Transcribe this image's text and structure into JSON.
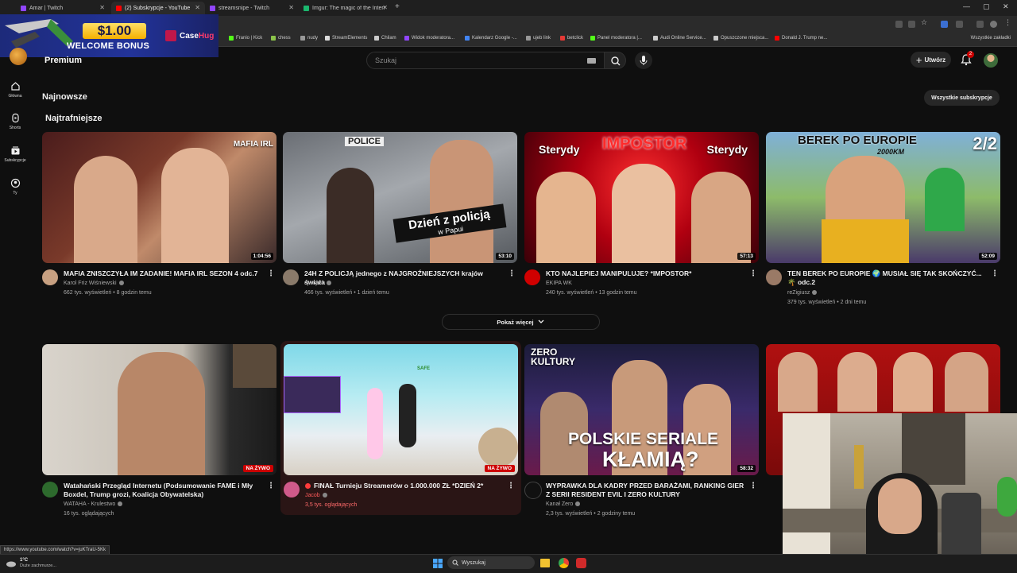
{
  "browser": {
    "tabs": [
      {
        "label": "Amar | Twitch",
        "active": false,
        "icon_color": "#9146ff"
      },
      {
        "label": "(2) Subskrypcje - YouTube",
        "active": true,
        "icon_color": "#ff0000"
      },
      {
        "label": "streamsnipe - Twitch",
        "active": false,
        "icon_color": "#9146ff"
      },
      {
        "label": "Imgur: The magic of the Intern",
        "active": false,
        "icon_color": "#1bb76e"
      }
    ],
    "new_tab": "+",
    "bookmarks": [
      {
        "label": "Franio | Kick",
        "color": "#53fc18"
      },
      {
        "label": "chess",
        "color": "#8bc34a"
      },
      {
        "label": "nudy",
        "color": "#999999"
      },
      {
        "label": "StreamElements",
        "color": "#dddddd"
      },
      {
        "label": "Chilam",
        "color": "#cccccc"
      },
      {
        "label": "Widok moderatora...",
        "color": "#9146ff"
      },
      {
        "label": "Kalendarz Google -...",
        "color": "#4285f4"
      },
      {
        "label": "ujeb link",
        "color": "#999999"
      },
      {
        "label": "betclick",
        "color": "#e53935"
      },
      {
        "label": "Panel moderatora |...",
        "color": "#53fc18"
      },
      {
        "label": "Audi Online Service...",
        "color": "#cccccc"
      },
      {
        "label": "Opuszczone miejsca...",
        "color": "#cccccc"
      },
      {
        "label": "Donald J. Trump ne...",
        "color": "#ff0000"
      }
    ],
    "all_bookmarks": "Wszystkie zakładki",
    "status_url": "https://www.youtube.com/watch?v=juKTraU-5Kk"
  },
  "ad": {
    "amount": "$1.00",
    "subtitle": "WELCOME BONUS",
    "brand_a": "Case",
    "brand_b": "Hug"
  },
  "header": {
    "premium_label": "Premium",
    "search_placeholder": "Szukaj",
    "create_label": "Utwórz",
    "notification_count": "2"
  },
  "nav": [
    {
      "label": "Główna",
      "icon": "home-icon"
    },
    {
      "label": "Shorts",
      "icon": "shorts-icon"
    },
    {
      "label": "Subskrypcje",
      "icon": "subscriptions-icon"
    },
    {
      "label": "Ty",
      "icon": "you-icon"
    }
  ],
  "sections": {
    "newest": "Najnowsze",
    "all_subscriptions": "Wszystkie subskrypcje",
    "most_relevant": "Najtrafniejsze",
    "show_more": "Pokaż więcej"
  },
  "videos_row1": [
    {
      "title": "MAFIA ZNISZCZYŁA IM ZADANIE! MAFIA IRL SEZON 4 odc.7",
      "channel": "Karol Friz Wiśniewski",
      "meta": "662 tys. wyświetleń • 8 godzin temu",
      "duration": "1:04:56",
      "thumb_text": "MAFIA IRL"
    },
    {
      "title": "24H Z POLICJĄ jednego z NAJGROŹNIEJSZYCH krajów świata",
      "channel": "ojwojtek",
      "meta": "466 tys. wyświetleń • 1 dzień temu",
      "duration": "53:10",
      "thumb_text": "Dzień z policją",
      "thumb_text2": "w Papui",
      "thumb_text3": "POLICE"
    },
    {
      "title": "KTO NAJLEPIEJ MANIPULUJE? *IMPOSTOR*",
      "channel": "EKIPA WK",
      "meta": "240 tys. wyświetleń • 13 godzin temu",
      "duration": "57:13",
      "thumb_text": "IMPOSTOR",
      "thumb_left": "Sterydy",
      "thumb_right": "Sterydy"
    },
    {
      "title": "TEN BEREK PO EUROPIE 🌍 MUSIAŁ SIĘ TAK SKOŃCZYĆ... 🌴 odc.2",
      "channel": "reZigiusz",
      "meta": "379 tys. wyświetleń • 2 dni temu",
      "duration": "52:09",
      "thumb_text": "BEREK PO EUROPIE",
      "thumb_text2": "2/2",
      "thumb_text3": "2000KM"
    }
  ],
  "videos_row2": [
    {
      "title": "Watahański Przegląd Internetu (Podsumowanie FAME i Mły Boxdel, Trump grozi, Koalicja Obywatelska)",
      "channel": "WATAHA - Krulestwo",
      "meta": "16 tys. oglądających",
      "badge": "NA ŻYWO"
    },
    {
      "title": "FINAŁ Turnieju Streamerów o 1.000.000 ZŁ *DZIEŃ 2*",
      "channel": "Jacob",
      "meta": "3,5 tys. oglądających",
      "badge": "NA ŻYWO",
      "thumb_text": "SAFE"
    },
    {
      "title": "WYPRAWKA DLA KADRY PRZED BARAŻAMI, RANKING GIER Z SERII RESIDENT EVIL I ZERO KULTURY",
      "channel": "Kanał Zero",
      "meta": "2,3 tys. wyświetleń • 2 godziny temu",
      "duration": "58:32",
      "thumb_text": "POLSKIE SERIALE",
      "thumb_text2": "KŁAMIĄ?",
      "thumb_text3": "ZERO KULTURY"
    },
    {
      "title": "",
      "channel": "",
      "meta": ""
    }
  ],
  "taskbar": {
    "weather_temp": "1°C",
    "weather_desc": "Duże zachmurze...",
    "search_label": "Wyszukaj"
  }
}
